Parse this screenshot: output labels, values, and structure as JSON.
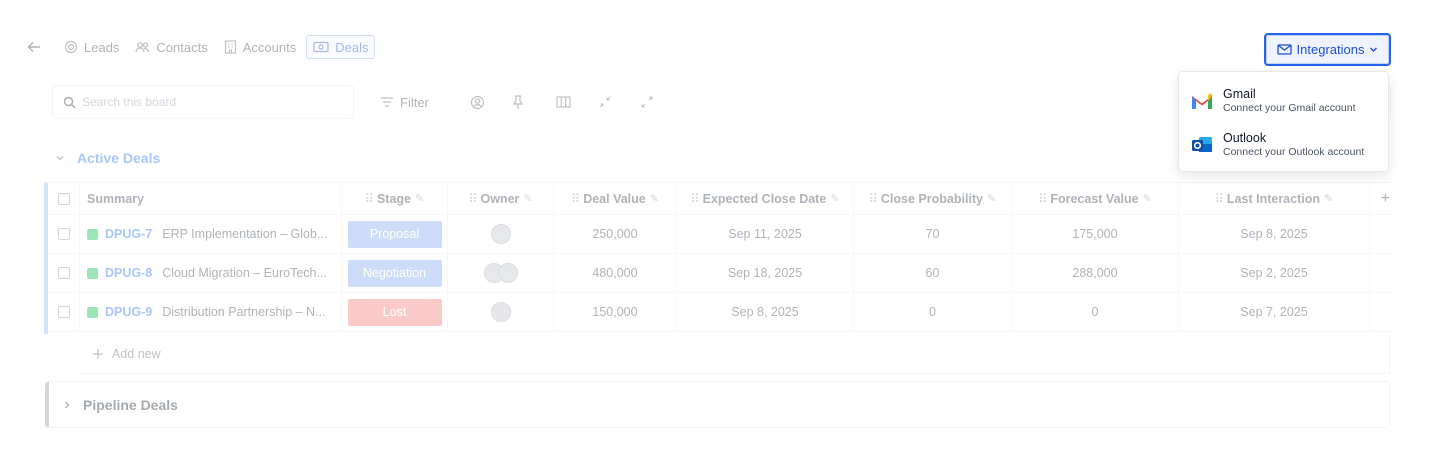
{
  "nav": {
    "tabs": [
      {
        "label": "Leads"
      },
      {
        "label": "Contacts"
      },
      {
        "label": "Accounts"
      },
      {
        "label": "Deals"
      }
    ]
  },
  "integrations": {
    "button_label": "Integrations",
    "items": [
      {
        "title": "Gmail",
        "subtitle": "Connect your Gmail account"
      },
      {
        "title": "Outlook",
        "subtitle": "Connect your Outlook account"
      }
    ]
  },
  "toolbar": {
    "search_placeholder": "Search this board",
    "filter_label": "Filter"
  },
  "group": {
    "title": "Active Deals"
  },
  "table": {
    "columns": [
      "Summary",
      "Stage",
      "Owner",
      "Deal Value",
      "Expected Close Date",
      "Close Probability",
      "Forecast Value",
      "Last Interaction"
    ],
    "add_column_label": "+",
    "rows": [
      {
        "key": "DPUG-7",
        "summary": "ERP Implementation – Glob...",
        "stage": "Proposal",
        "stage_color": "#8fb0f0",
        "deal_value": "250,000",
        "close_date": "Sep 11, 2025",
        "probability": "70",
        "forecast": "175,000",
        "last_interaction": "Sep 8, 2025"
      },
      {
        "key": "DPUG-8",
        "summary": "Cloud Migration – EuroTech...",
        "stage": "Negotiation",
        "stage_color": "#8fb0f0",
        "deal_value": "480,000",
        "close_date": "Sep 18, 2025",
        "probability": "60",
        "forecast": "288,000",
        "last_interaction": "Sep 2, 2025"
      },
      {
        "key": "DPUG-9",
        "summary": "Distribution Partnership – N...",
        "stage": "Lost",
        "stage_color": "#f28a82",
        "deal_value": "150,000",
        "close_date": "Sep 8, 2025",
        "probability": "0",
        "forecast": "0",
        "last_interaction": "Sep 7, 2025"
      }
    ],
    "add_new_label": "Add new"
  },
  "pipeline": {
    "title": "Pipeline Deals"
  },
  "colors": {
    "accent": "#2563eb",
    "gmail_red": "#ea4335",
    "outlook_blue": "#0a64c8",
    "row_key_icon": "#22c55e"
  }
}
